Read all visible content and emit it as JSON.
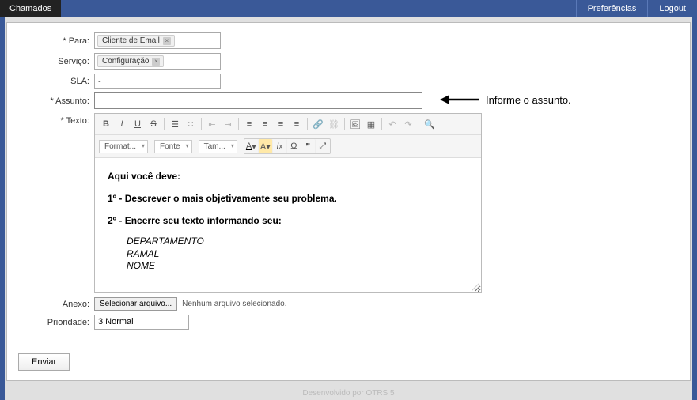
{
  "topbar": {
    "tab": "Chamados",
    "preferences": "Preferências",
    "logout": "Logout"
  },
  "labels": {
    "para": "* Para:",
    "servico": "Serviço:",
    "sla": "SLA:",
    "assunto": "* Assunto:",
    "texto": "* Texto:",
    "anexo": "Anexo:",
    "prioridade": "Prioridade:"
  },
  "fields": {
    "para_tag": "Cliente de Email",
    "servico_tag": "Configuração",
    "sla_value": "-",
    "assunto_value": "",
    "prioridade_value": "3 Normal"
  },
  "annotation": {
    "subject_hint": "Informe o assunto."
  },
  "toolbar": {
    "format": "Format...",
    "fonte": "Fonte",
    "tam": "Tam..."
  },
  "editor": {
    "p1": "Aqui você deve:",
    "p2": "1º - Descrever o mais objetivamente seu problema.",
    "p3": "2º - Encerre seu texto informando seu:",
    "d1": "DEPARTAMENTO",
    "d2": "RAMAL",
    "d3": "NOME"
  },
  "attachment": {
    "button": "Selecionar arquivo...",
    "status": "Nenhum arquivo selecionado."
  },
  "submit": {
    "label": "Enviar"
  },
  "footer": "Desenvolvido por OTRS 5"
}
